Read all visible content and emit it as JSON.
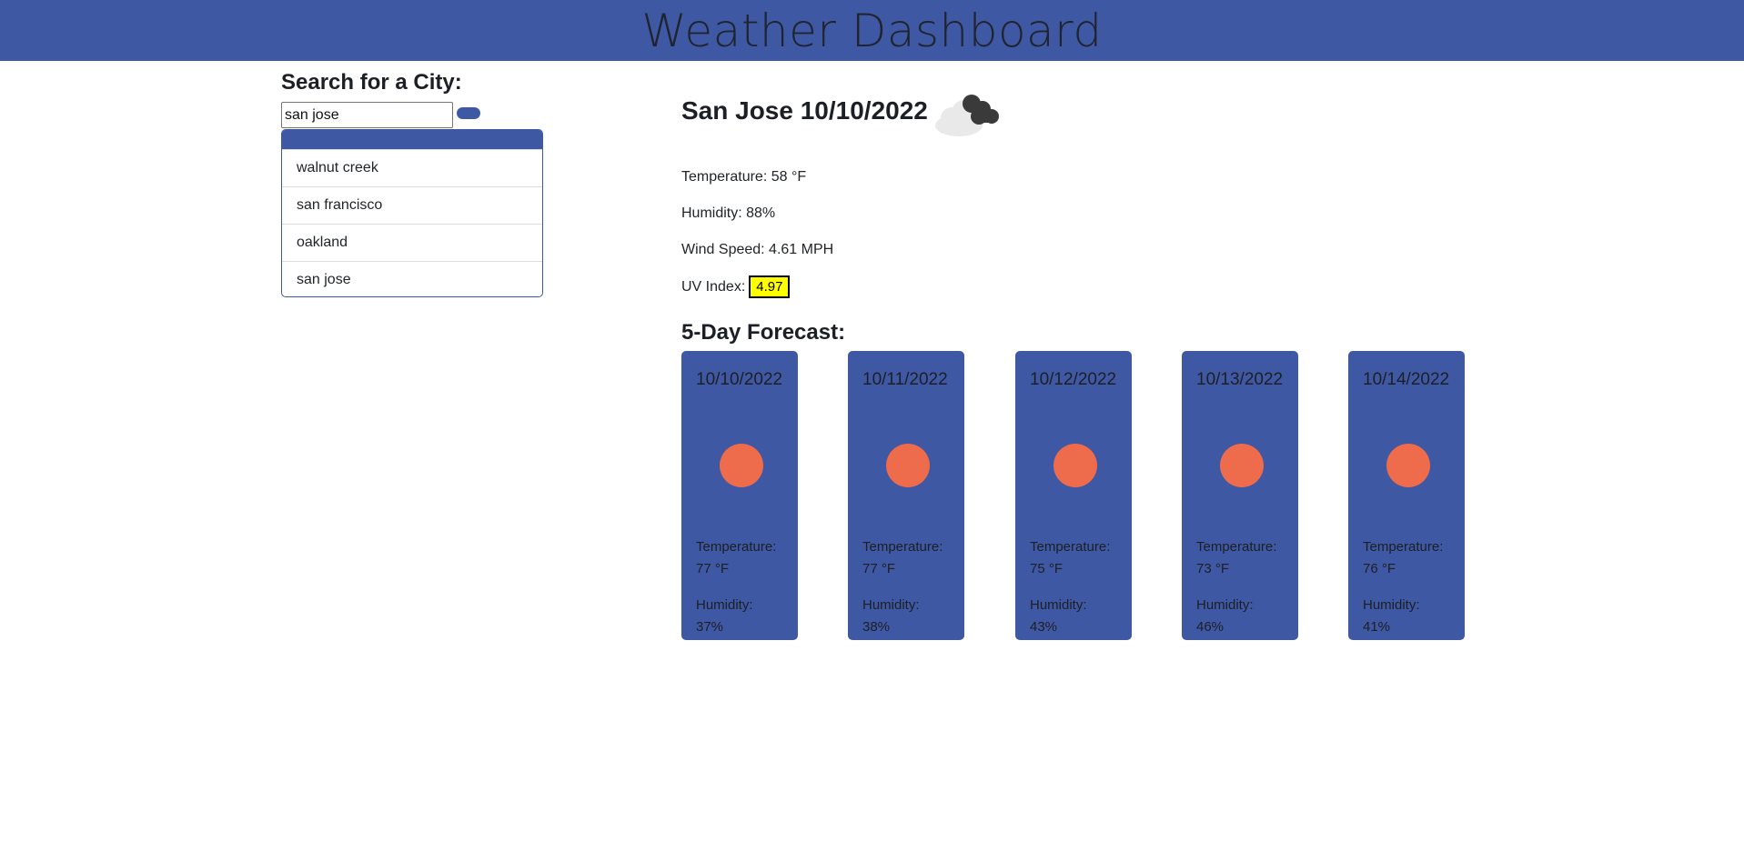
{
  "header": {
    "title": "Weather Dashboard"
  },
  "search": {
    "title": "Search for a City:",
    "value": "san jose",
    "history": [
      "walnut creek",
      "san francisco",
      "oakland",
      "san jose"
    ]
  },
  "current": {
    "title": "San Jose 10/10/2022",
    "icon": "clouds-icon",
    "temperature": "Temperature: 58 °F",
    "humidity": "Humidity: 88%",
    "wind": "Wind Speed: 4.61 MPH",
    "uv_label": "UV Index:",
    "uv_value": "4.97"
  },
  "forecast": {
    "title": "5-Day Forecast:",
    "days": [
      {
        "date": "10/10/2022",
        "temp_label": "Temperature:",
        "temp": "77 °F",
        "hum_label": "Humidity:",
        "hum": "37%",
        "icon": "sun-icon"
      },
      {
        "date": "10/11/2022",
        "temp_label": "Temperature:",
        "temp": "77 °F",
        "hum_label": "Humidity:",
        "hum": "38%",
        "icon": "sun-icon"
      },
      {
        "date": "10/12/2022",
        "temp_label": "Temperature:",
        "temp": "75 °F",
        "hum_label": "Humidity:",
        "hum": "43%",
        "icon": "sun-icon"
      },
      {
        "date": "10/13/2022",
        "temp_label": "Temperature:",
        "temp": "73 °F",
        "hum_label": "Humidity:",
        "hum": "46%",
        "icon": "sun-icon"
      },
      {
        "date": "10/14/2022",
        "temp_label": "Temperature:",
        "temp": "76 °F",
        "hum_label": "Humidity:",
        "hum": "41%",
        "icon": "sun-icon"
      }
    ]
  },
  "colors": {
    "primary": "#3f58a3",
    "sun": "#ee6b4b",
    "uv": "#ffff00"
  }
}
